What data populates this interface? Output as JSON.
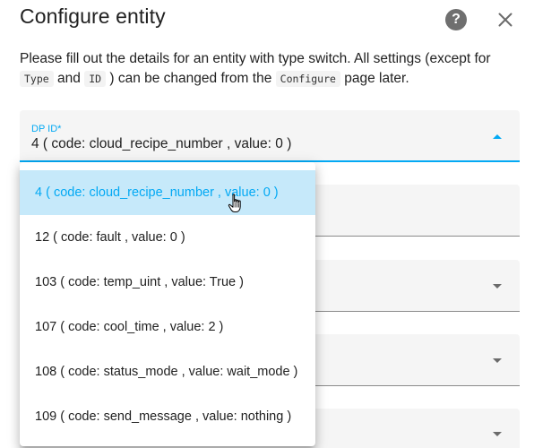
{
  "dialog": {
    "title": "Configure entity",
    "help_icon": "help-circle-icon",
    "close_icon": "close-icon"
  },
  "description": {
    "part1": "Please fill out the details for an entity with type switch. All settings (except for",
    "code1": "Type",
    "and": "and",
    "code2": "ID",
    "part2": ") can be changed from the",
    "code3": "Configure",
    "part3": "page later."
  },
  "dp_field": {
    "label": "DP ID*",
    "value": "4 ( code: cloud_recipe_number , value: 0 )"
  },
  "dropdown": {
    "selected_index": 0,
    "options": [
      "4 ( code: cloud_recipe_number , value: 0 )",
      "12 ( code: fault , value: 0 )",
      "103 ( code: temp_uint , value: True )",
      "107 ( code: cool_time , value: 2 )",
      "108 ( code: status_mode , value: wait_mode )",
      "109 ( code: send_message , value: nothing )"
    ]
  },
  "colors": {
    "accent": "#03a9f4",
    "selected_bg": "#c6e9fa",
    "field_bg": "#f5f5f5"
  }
}
